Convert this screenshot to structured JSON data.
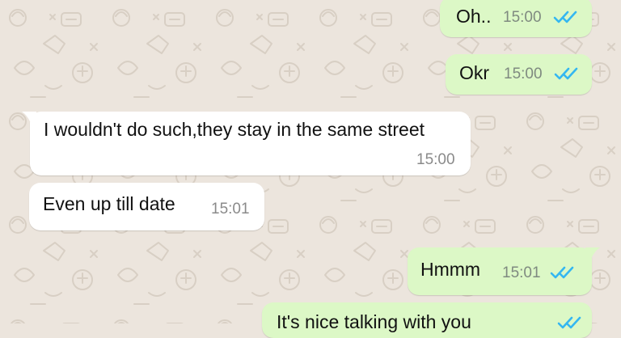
{
  "chat": {
    "messages": [
      {
        "id": "m1",
        "direction": "outgoing",
        "text": "Oh..",
        "time": "15:00",
        "status_icon": "double-check-icon"
      },
      {
        "id": "m2",
        "direction": "outgoing",
        "text": "Okr",
        "time": "15:00",
        "status_icon": "double-check-icon"
      },
      {
        "id": "m3",
        "direction": "incoming",
        "text": "I wouldn't do such,they stay in the same street",
        "time": "15:00"
      },
      {
        "id": "m4",
        "direction": "incoming",
        "text": "Even up till date",
        "time": "15:01"
      },
      {
        "id": "m5",
        "direction": "outgoing",
        "text": "Hmmm",
        "time": "15:01",
        "status_icon": "double-check-icon"
      },
      {
        "id": "m6",
        "direction": "outgoing",
        "text": "It's nice talking with you",
        "time": "",
        "status_icon": "double-check-icon"
      }
    ]
  },
  "colors": {
    "background": "#ece5dd",
    "outgoing_bubble": "#dcf8c6",
    "incoming_bubble": "#ffffff",
    "read_tick": "#34b7f1",
    "timestamp": "#7f8a80"
  }
}
